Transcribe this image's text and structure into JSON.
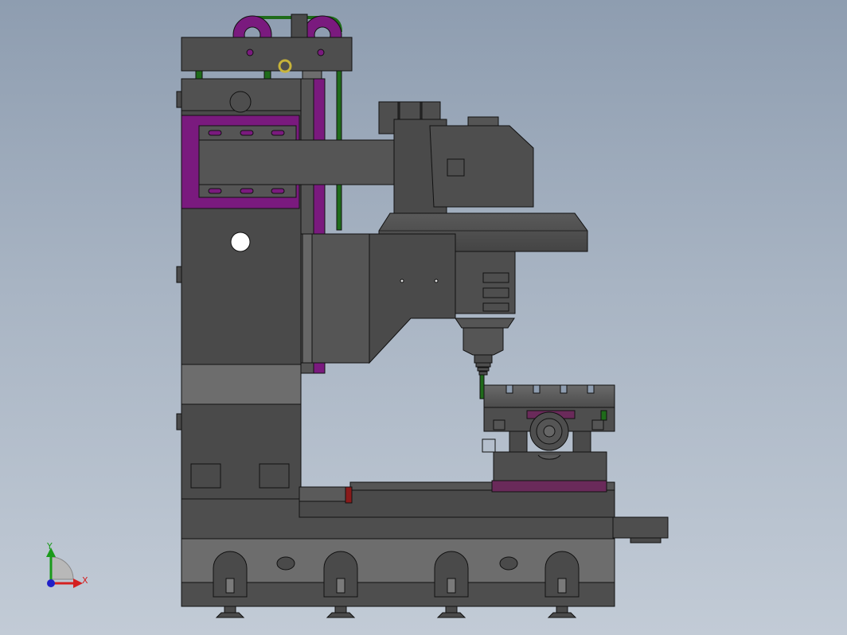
{
  "colors": {
    "body_dark": "#4a4a4a",
    "body_mid": "#575757",
    "body_light": "#6d6d6d",
    "accent_purple": "#7a1a7e",
    "accent_green": "#1f6b1a",
    "accent_red": "#8a1a1a",
    "edge": "#111111",
    "background_top": "#8e9db0",
    "background_bottom": "#c2cbd6"
  },
  "triad": {
    "y_label": "Y",
    "x_label": "X",
    "y_color": "#1a9a1a",
    "x_color": "#d42020",
    "z_color": "#2020c8"
  }
}
